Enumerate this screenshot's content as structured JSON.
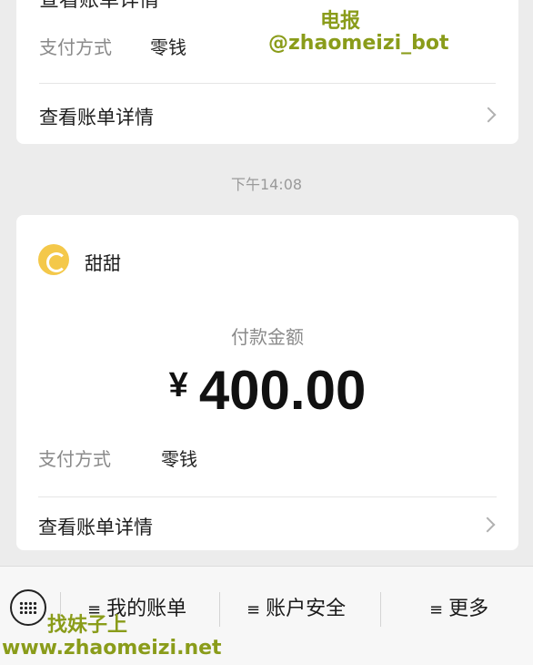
{
  "prev_card": {
    "cut_link": "查看账单详情",
    "pay_method_label": "支付方式",
    "pay_method_value": "零钱",
    "detail_link": "查看账单详情"
  },
  "timestamp": "下午14:08",
  "payment": {
    "merchant": "甜甜",
    "amount_title": "付款金额",
    "currency": "¥",
    "amount": "400.00",
    "pay_method_label": "支付方式",
    "pay_method_value": "零钱",
    "detail_link": "查看账单详情"
  },
  "bottom_nav": {
    "menu_icon": "≡",
    "items": [
      {
        "label": "我的账单"
      },
      {
        "label": "账户安全"
      },
      {
        "label": "更多"
      }
    ]
  },
  "watermarks": {
    "line1": "电报",
    "line2": "@zhaomeizi_bot",
    "line3": "找妹子上",
    "line4": "www.zhaomeizi.net"
  },
  "icons": {
    "avatar": "merchant-avatar-icon",
    "keyboard": "keyboard-icon",
    "chevron": "chevron-right-icon"
  },
  "colors": {
    "background": "#ececec",
    "card": "#ffffff",
    "avatar": "#f4c84a",
    "watermark": "#8a9c1a"
  }
}
